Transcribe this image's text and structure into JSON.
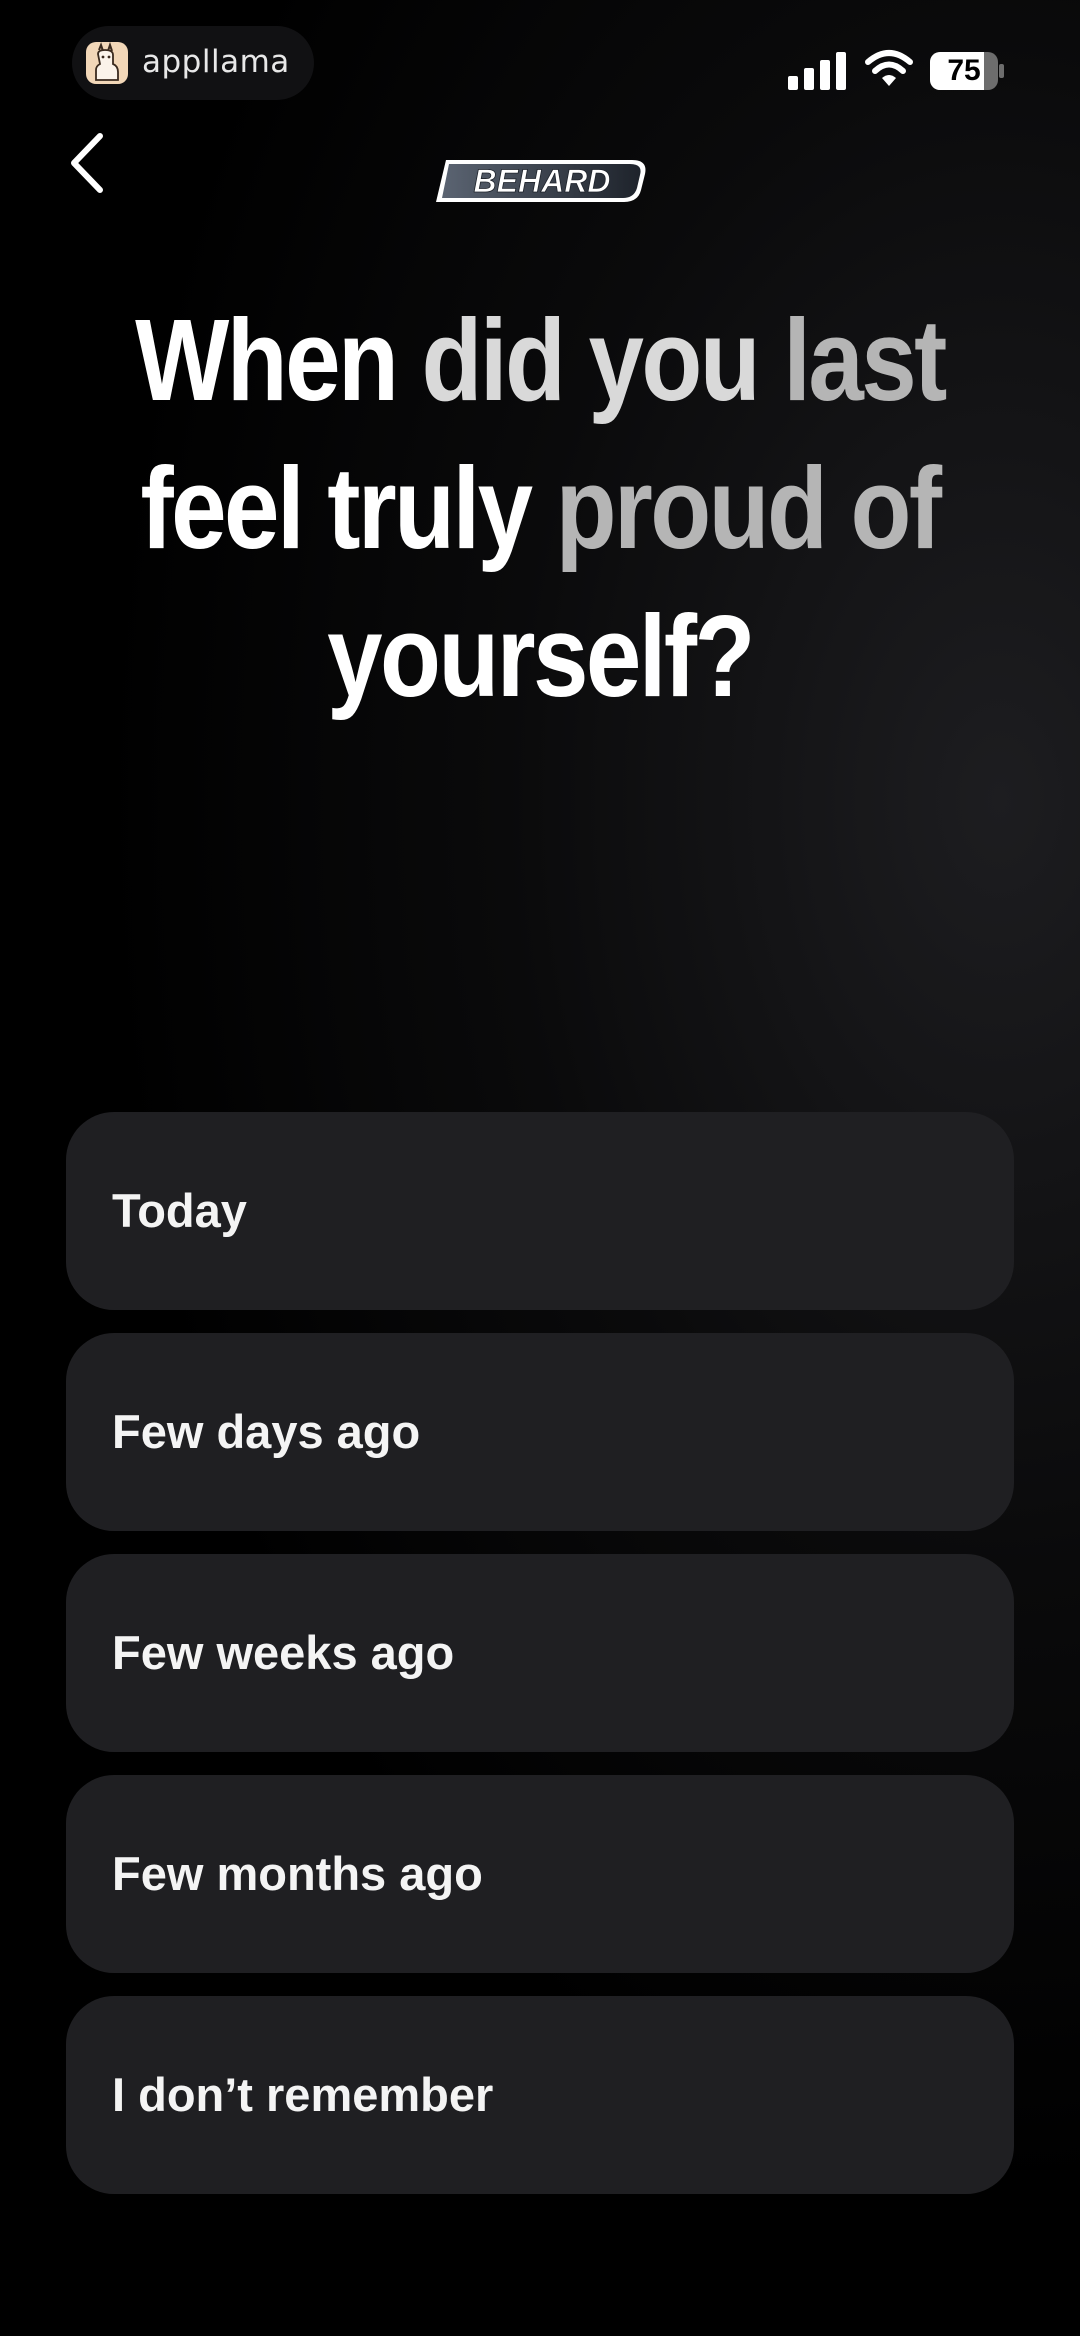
{
  "status_bar": {
    "app_name": "appllama",
    "battery_level": "75"
  },
  "header": {
    "logo_text": "BEHARD"
  },
  "question": {
    "part1": "When ",
    "part2": "did you ",
    "part3": "last ",
    "part4": "feel truly ",
    "part5": "proud of ",
    "part6": "yourself?"
  },
  "options": [
    {
      "label": "Today"
    },
    {
      "label": "Few days ago"
    },
    {
      "label": "Few weeks ago"
    },
    {
      "label": "Few months ago"
    },
    {
      "label": "I don’t remember"
    }
  ],
  "colors": {
    "background": "#000000",
    "option_bg": "#1f1f22",
    "text": "#ffffff"
  }
}
